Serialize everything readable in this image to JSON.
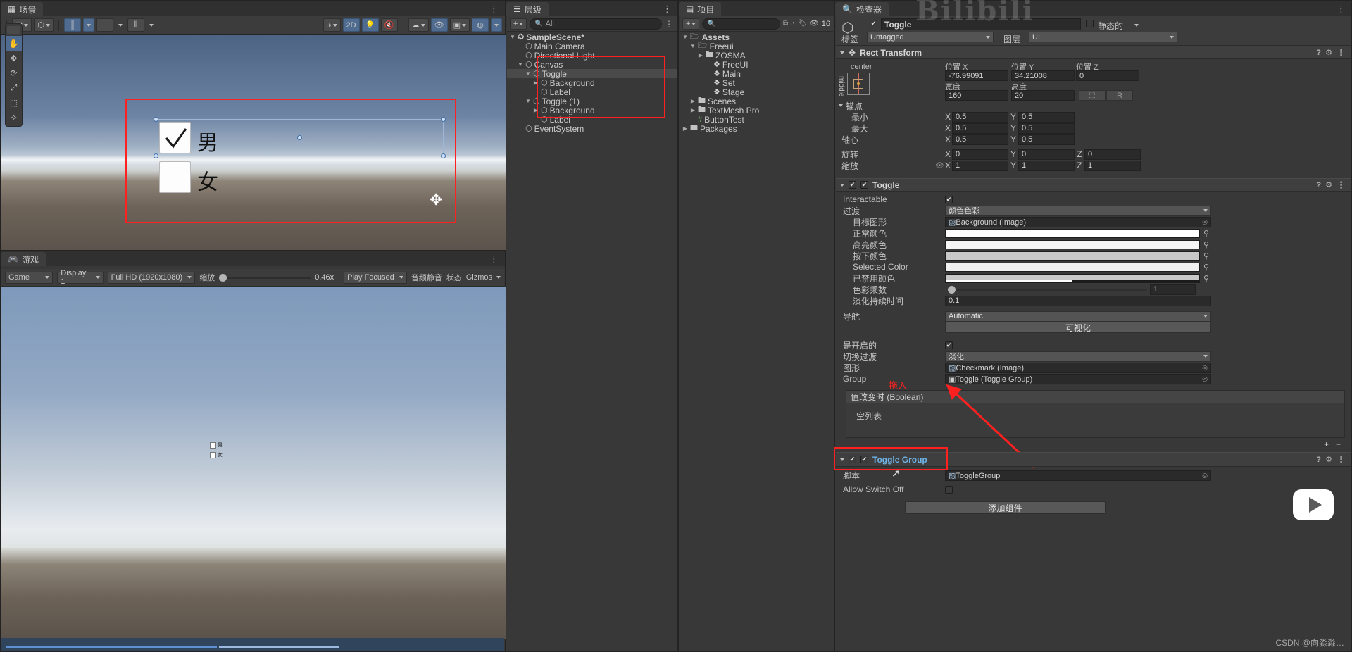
{
  "scene": {
    "tab": "场景",
    "toolbar": {
      "pivot_icon": "pivot-icon",
      "pivot_global_icon": "global-icon",
      "grid_icon": "grid-snap-icon",
      "grid2_icon": "grid-icon",
      "ruler_icon": "ruler-icon",
      "shading_icon": "shading-sphere-icon",
      "twod_label": "2D",
      "light_icon": "light-bulb-icon",
      "audio_icon": "audio-mute-icon",
      "fx_icon": "effects-icon",
      "visibility_icon": "scene-visibility-icon",
      "camera_icon": "scene-camera-icon",
      "gizmos_icon": "gizmos-icon",
      "menu_icon": "overflow-menu-icon"
    },
    "tools": [
      "hand-tool",
      "move-tool",
      "rotate-tool",
      "scale-tool",
      "rect-tool",
      "transform-tool"
    ],
    "canvas": {
      "male_label": "男",
      "female_label": "女"
    }
  },
  "game": {
    "tab": "游戏",
    "controls": {
      "view": "Game",
      "display": "Display 1",
      "resolution": "Full HD (1920x1080)",
      "scale_label": "缩放",
      "scale_value": "0.46x",
      "play_focus": "Play Focused",
      "mute": "音频静音",
      "stats": "状态",
      "gizmos": "Gizmos"
    },
    "preview": {
      "male_label": "男",
      "female_label": "女"
    }
  },
  "hierarchy": {
    "tab": "层级",
    "search_placeholder": "All",
    "add_label": "+",
    "rows": [
      {
        "label": "SampleScene*",
        "depth": 0,
        "arrow": "down",
        "icon": "scene-icon",
        "selected": false,
        "bold": true
      },
      {
        "label": "Main Camera",
        "depth": 1,
        "arrow": "",
        "icon": "gameobject-icon",
        "selected": false,
        "bold": false
      },
      {
        "label": "Directional Light",
        "depth": 1,
        "arrow": "",
        "icon": "gameobject-icon",
        "selected": false,
        "bold": false
      },
      {
        "label": "Canvas",
        "depth": 1,
        "arrow": "down",
        "icon": "gameobject-icon",
        "selected": false,
        "bold": false
      },
      {
        "label": "Toggle",
        "depth": 2,
        "arrow": "down",
        "icon": "gameobject-icon",
        "selected": true,
        "bold": false
      },
      {
        "label": "Background",
        "depth": 3,
        "arrow": "right",
        "icon": "gameobject-icon",
        "selected": false,
        "bold": false
      },
      {
        "label": "Label",
        "depth": 3,
        "arrow": "",
        "icon": "gameobject-icon",
        "selected": false,
        "bold": false
      },
      {
        "label": "Toggle (1)",
        "depth": 2,
        "arrow": "down",
        "icon": "gameobject-icon",
        "selected": false,
        "bold": false
      },
      {
        "label": "Background",
        "depth": 3,
        "arrow": "right",
        "icon": "gameobject-icon",
        "selected": false,
        "bold": false
      },
      {
        "label": "Label",
        "depth": 3,
        "arrow": "",
        "icon": "gameobject-icon",
        "selected": false,
        "bold": false
      },
      {
        "label": "EventSystem",
        "depth": 1,
        "arrow": "",
        "icon": "gameobject-icon",
        "selected": false,
        "bold": false
      }
    ]
  },
  "project": {
    "tab": "项目",
    "add_label": "+",
    "badge_count": "16",
    "rows": [
      {
        "label": "Assets",
        "depth": 0,
        "arrow": "down",
        "icon": "folder-open-icon",
        "bold": true
      },
      {
        "label": "Freeui",
        "depth": 1,
        "arrow": "down",
        "icon": "folder-open-icon",
        "bold": false
      },
      {
        "label": "ZOSMA",
        "depth": 2,
        "arrow": "right",
        "icon": "folder-icon",
        "bold": false
      },
      {
        "label": "FreeUI",
        "depth": 3,
        "arrow": "",
        "icon": "unity-asset-icon",
        "bold": false
      },
      {
        "label": "Main",
        "depth": 3,
        "arrow": "",
        "icon": "unity-asset-icon",
        "bold": false
      },
      {
        "label": "Set",
        "depth": 3,
        "arrow": "",
        "icon": "unity-asset-icon",
        "bold": false
      },
      {
        "label": "Stage",
        "depth": 3,
        "arrow": "",
        "icon": "unity-asset-icon",
        "bold": false
      },
      {
        "label": "Scenes",
        "depth": 1,
        "arrow": "right",
        "icon": "folder-icon",
        "bold": false
      },
      {
        "label": "TextMesh Pro",
        "depth": 1,
        "arrow": "right",
        "icon": "folder-icon",
        "bold": false
      },
      {
        "label": "ButtonTest",
        "depth": 1,
        "arrow": "",
        "icon": "csharp-script-icon",
        "bold": false
      },
      {
        "label": "Packages",
        "depth": 0,
        "arrow": "right",
        "icon": "folder-icon",
        "bold": false
      }
    ]
  },
  "inspector": {
    "tab": "检查器",
    "object_name": "Toggle",
    "object_enabled": true,
    "static_label": "静态的",
    "tag_label": "标签",
    "tag_value": "Untagged",
    "layer_label": "图层",
    "layer_value": "UI",
    "rect_transform": {
      "title": "Rect Transform",
      "anchor_preset_h": "center",
      "anchor_preset_v": "middle",
      "pos_x_label": "位置 X",
      "pos_x": "-76.99091",
      "pos_y_label": "位置 Y",
      "pos_y": "34.21008",
      "pos_z_label": "位置 Z",
      "pos_z": "0",
      "width_label": "宽度",
      "width": "160",
      "height_label": "高度",
      "height": "20",
      "blueprint_label": "R",
      "anchors_label": "锚点",
      "min_label": "最小",
      "min_x": "0.5",
      "min_y": "0.5",
      "max_label": "最大",
      "max_x": "0.5",
      "max_y": "0.5",
      "pivot_label": "轴心",
      "pivot_x": "0.5",
      "pivot_y": "0.5",
      "rotation_label": "旋转",
      "rot_x": "0",
      "rot_y": "0",
      "rot_z": "0",
      "scale_label": "缩放",
      "scale_x": "1",
      "scale_y": "1",
      "scale_z": "1"
    },
    "toggle": {
      "title": "Toggle",
      "enabled": true,
      "interactable_label": "Interactable",
      "interactable": true,
      "transition_label": "过渡",
      "transition_value": "颜色色彩",
      "target_graphic_label": "目标图形",
      "target_graphic_value": "Background (Image)",
      "normal_color_label": "正常颜色",
      "normal_color": "#ffffff",
      "highlighted_color_label": "高亮颜色",
      "highlighted_color": "#f5f5f5",
      "pressed_color_label": "按下颜色",
      "pressed_color": "#c8c8c8",
      "selected_color_label": "Selected Color",
      "selected_color": "#f0f0f0",
      "disabled_color_label": "已禁用颜色",
      "disabled_color": "#c8c8c8",
      "color_multiplier_label": "色彩乘数",
      "color_multiplier": "1",
      "fade_duration_label": "淡化持续时间",
      "fade_duration": "0.1",
      "navigation_label": "导航",
      "navigation_value": "Automatic",
      "visualize_label": "可视化",
      "is_on_label": "是开启的",
      "is_on": true,
      "toggle_transition_label": "切换过渡",
      "toggle_transition_value": "淡化",
      "graphic_label": "图形",
      "graphic_value": "Checkmark (Image)",
      "group_label": "Group",
      "group_value": "Toggle (Toggle Group)",
      "group_annotation": "拖入",
      "event_header": "值改变时 (Boolean)",
      "event_empty": "空列表",
      "add_btn": "+",
      "remove_btn": "−"
    },
    "toggle_group": {
      "title": "Toggle Group",
      "enabled": true,
      "script_label": "脚本",
      "script_value": "ToggleGroup",
      "allow_switch_off_label": "Allow Switch Off",
      "allow_switch_off": false
    },
    "add_component_label": "添加组件"
  },
  "watermark": "CSDN @向淼淼…"
}
